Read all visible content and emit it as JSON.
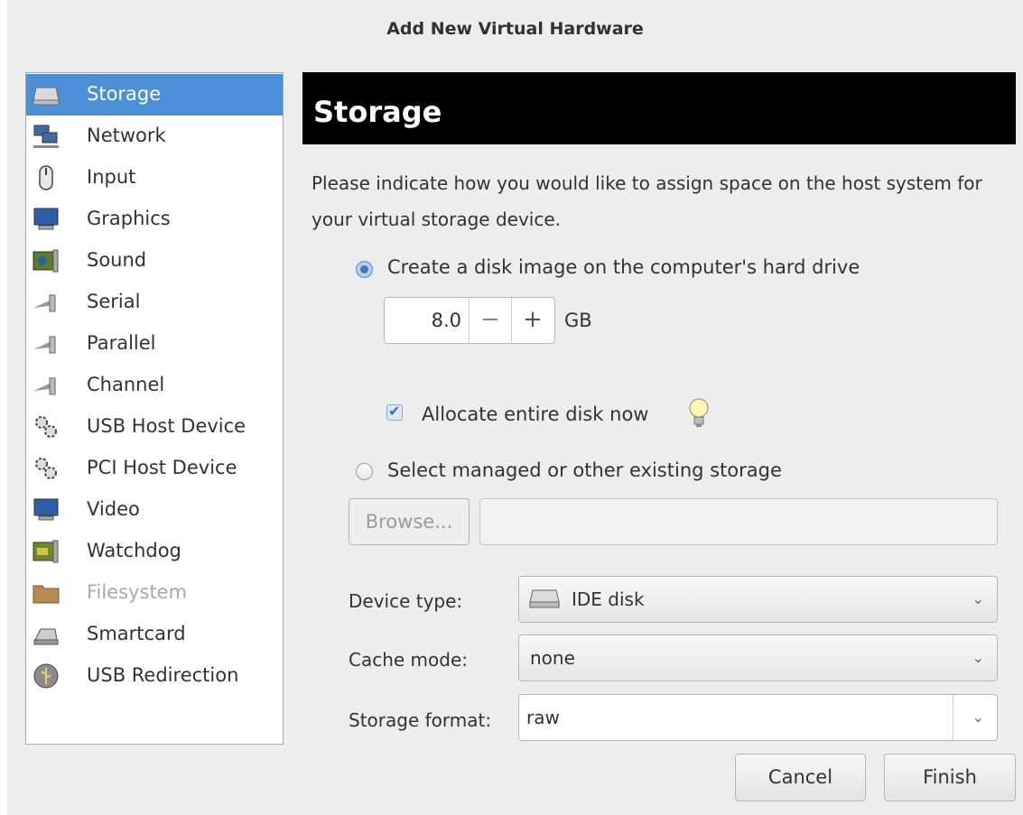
{
  "window": {
    "title": "Add New Virtual Hardware"
  },
  "sidebar": {
    "items": [
      {
        "label": "Storage",
        "icon": "hard-disk-icon",
        "selected": true,
        "enabled": true
      },
      {
        "label": "Network",
        "icon": "network-icon",
        "selected": false,
        "enabled": true
      },
      {
        "label": "Input",
        "icon": "mouse-icon",
        "selected": false,
        "enabled": true
      },
      {
        "label": "Graphics",
        "icon": "monitor-icon",
        "selected": false,
        "enabled": true
      },
      {
        "label": "Sound",
        "icon": "sound-card-icon",
        "selected": false,
        "enabled": true
      },
      {
        "label": "Serial",
        "icon": "serial-plug-icon",
        "selected": false,
        "enabled": true
      },
      {
        "label": "Parallel",
        "icon": "parallel-plug-icon",
        "selected": false,
        "enabled": true
      },
      {
        "label": "Channel",
        "icon": "channel-plug-icon",
        "selected": false,
        "enabled": true
      },
      {
        "label": "USB Host Device",
        "icon": "gears-icon",
        "selected": false,
        "enabled": true
      },
      {
        "label": "PCI Host Device",
        "icon": "gears-icon",
        "selected": false,
        "enabled": true
      },
      {
        "label": "Video",
        "icon": "monitor-icon",
        "selected": false,
        "enabled": true
      },
      {
        "label": "Watchdog",
        "icon": "board-icon",
        "selected": false,
        "enabled": true
      },
      {
        "label": "Filesystem",
        "icon": "folder-icon",
        "selected": false,
        "enabled": false
      },
      {
        "label": "Smartcard",
        "icon": "card-reader-icon",
        "selected": false,
        "enabled": true
      },
      {
        "label": "USB Redirection",
        "icon": "usb-icon",
        "selected": false,
        "enabled": true
      }
    ]
  },
  "page": {
    "header": "Storage",
    "description": "Please indicate how you would like to assign space on the host system for your virtual storage device.",
    "create_disk_label": "Create a disk image on the computer's hard drive",
    "size_value": "8.0",
    "size_minus": "−",
    "size_plus": "+",
    "size_unit": "GB",
    "allocate_label": "Allocate entire disk now",
    "select_existing_label": "Select managed or other existing storage",
    "browse_label": "Browse...",
    "browse_path": "",
    "device_type_label": "Device type:",
    "device_type_value": "IDE disk",
    "cache_mode_label": "Cache mode:",
    "cache_mode_value": "none",
    "storage_format_label": "Storage format:",
    "storage_format_value": "raw"
  },
  "buttons": {
    "cancel": "Cancel",
    "finish": "Finish"
  },
  "state": {
    "create_disk_selected": true,
    "allocate_checked": true,
    "select_existing_selected": false
  },
  "colors": {
    "selection": "#4a90d9",
    "header_bg": "#000000",
    "header_fg": "#ffffff"
  }
}
